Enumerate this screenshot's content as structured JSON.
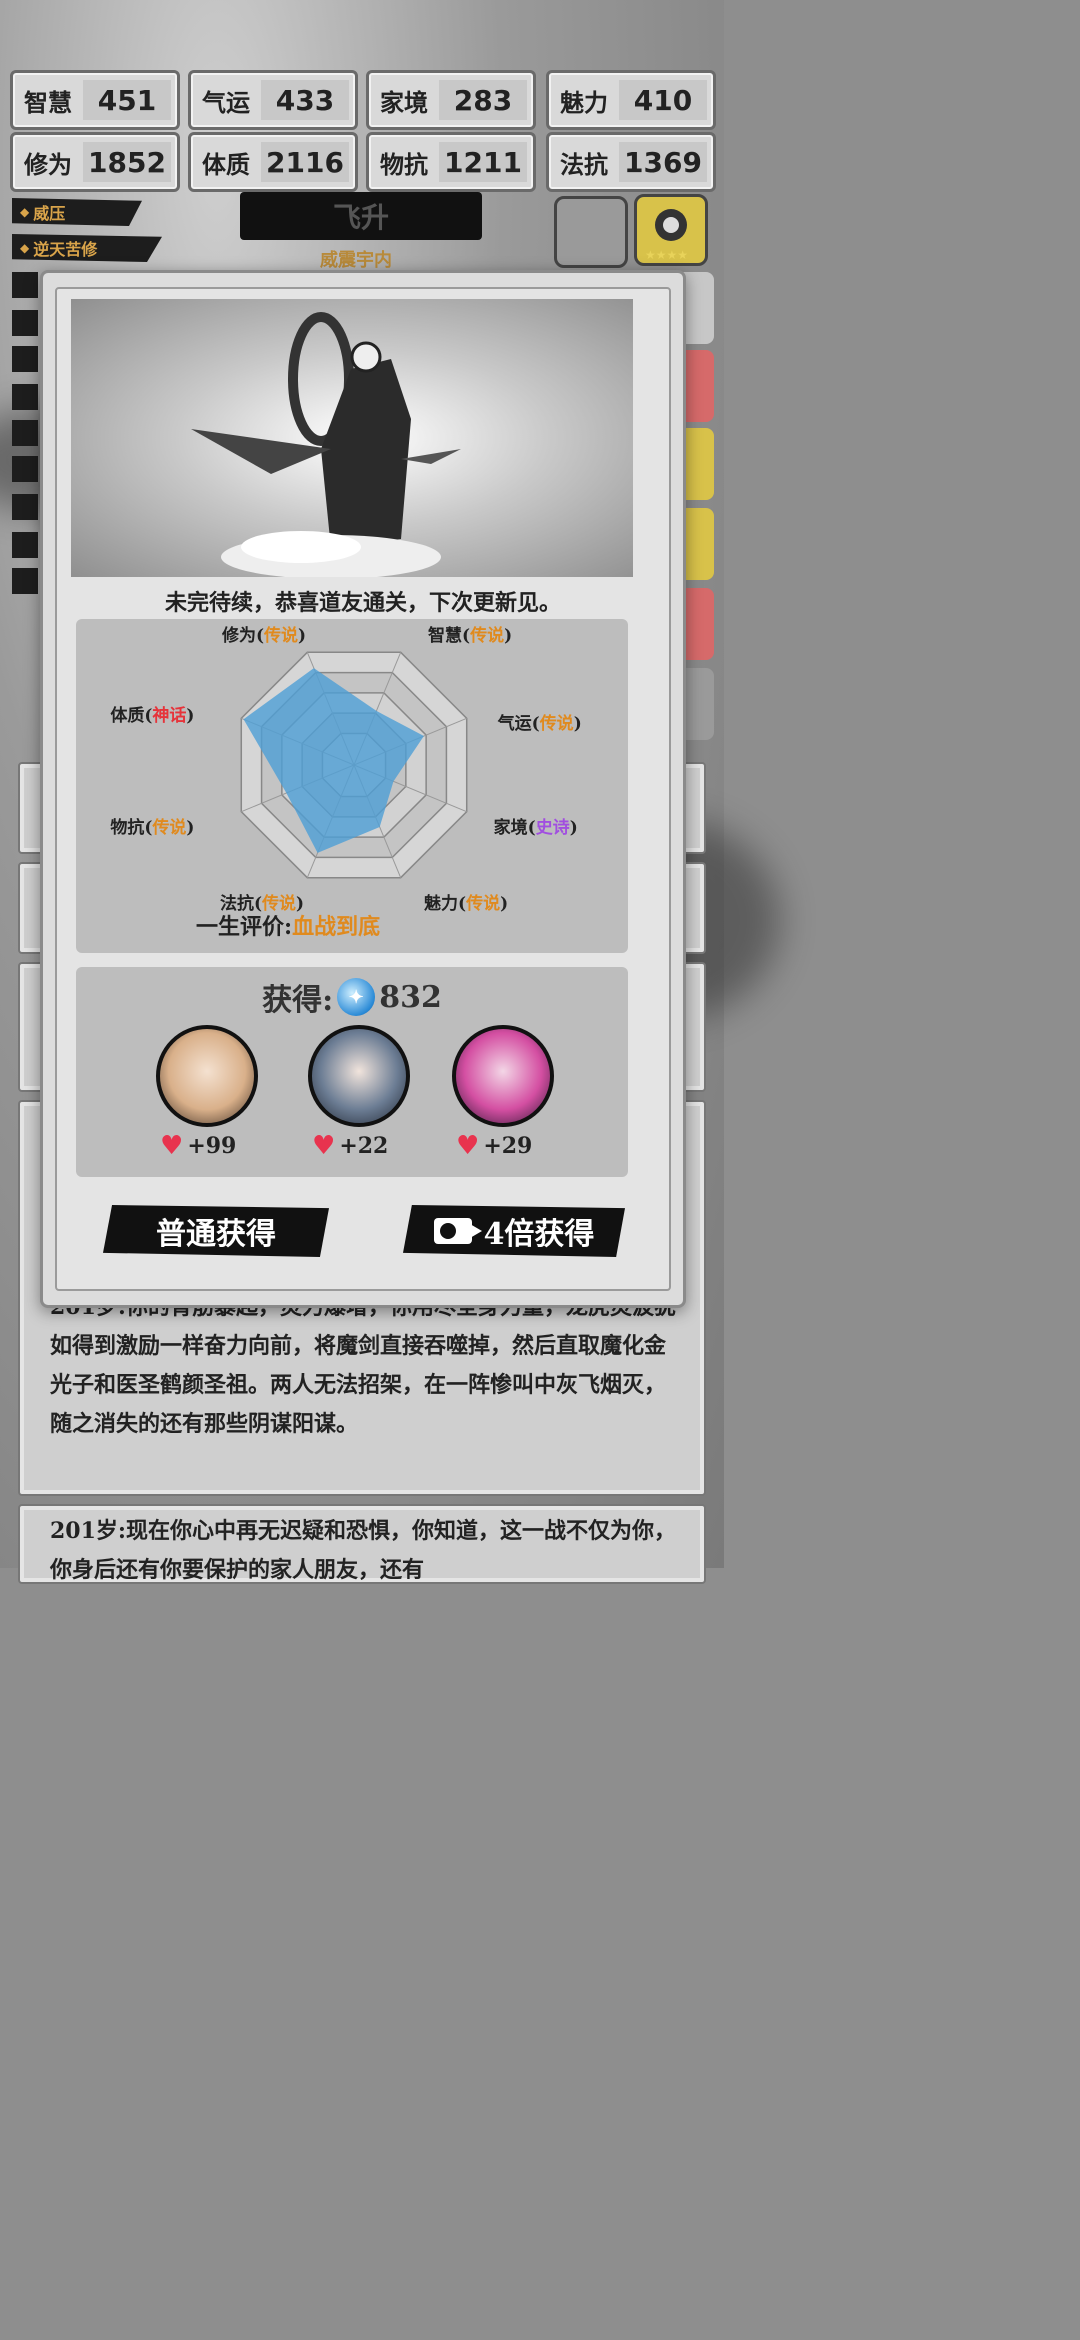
{
  "stats": [
    {
      "label": "智慧",
      "value": "451"
    },
    {
      "label": "气运",
      "value": "433"
    },
    {
      "label": "家境",
      "value": "283"
    },
    {
      "label": "魅力",
      "value": "410"
    },
    {
      "label": "修为",
      "value": "1852"
    },
    {
      "label": "体质",
      "value": "2116"
    },
    {
      "label": "物抗",
      "value": "1211"
    },
    {
      "label": "法抗",
      "value": "1369"
    }
  ],
  "tags": [
    "威压",
    "逆天苦修"
  ],
  "title": {
    "main": "飞升",
    "sub": "威震宇内"
  },
  "modal": {
    "message": "未完待续，恭喜道友通关，下次更新见。",
    "radar": {
      "axes": [
        {
          "name": "修为",
          "quality": "传说",
          "qclass": "q-leg",
          "score": 0.86
        },
        {
          "name": "智慧",
          "quality": "传说",
          "qclass": "q-leg",
          "score": 0.48
        },
        {
          "name": "气运",
          "quality": "传说",
          "qclass": "q-leg",
          "score": 0.62
        },
        {
          "name": "家境",
          "quality": "史诗",
          "qclass": "q-epic",
          "score": 0.35
        },
        {
          "name": "魅力",
          "quality": "传说",
          "qclass": "q-leg",
          "score": 0.55
        },
        {
          "name": "法抗",
          "quality": "传说",
          "qclass": "q-leg",
          "score": 0.78
        },
        {
          "name": "物抗",
          "quality": "传说",
          "qclass": "q-leg",
          "score": 0.6
        },
        {
          "name": "体质",
          "quality": "神话",
          "qclass": "q-myth",
          "score": 0.98
        }
      ]
    },
    "evaluation": {
      "label": "一生评价:",
      "value": "血战到底"
    },
    "reward": {
      "label": "获得:",
      "amount": "832"
    },
    "characters": [
      {
        "favor": "+99",
        "color": "#d9b08a"
      },
      {
        "favor": "+22",
        "color": "#6c7d94"
      },
      {
        "favor": "+29",
        "color": "#d44fa2"
      }
    ],
    "buttons": {
      "normal": "普通获得",
      "video": "4倍获得"
    }
  },
  "log": [
    {
      "age": "201岁:",
      "text": "你的青筋暴起，灵力爆增，你用尽全身力量，龙虎灵波犹如得到激励一样奋力向前，将魔剑直接吞噬掉，然后直取魔化金光子和医圣鹤颜圣祖。两人无法招架，在一阵惨叫中灰飞烟灭，随之消失的还有那些阴谋阳谋。"
    },
    {
      "age": "201岁:",
      "text": "现在你心中再无迟疑和恐惧，你知道，这一战不仅为你，你身后还有你要保护的家人朋友，还有"
    }
  ]
}
